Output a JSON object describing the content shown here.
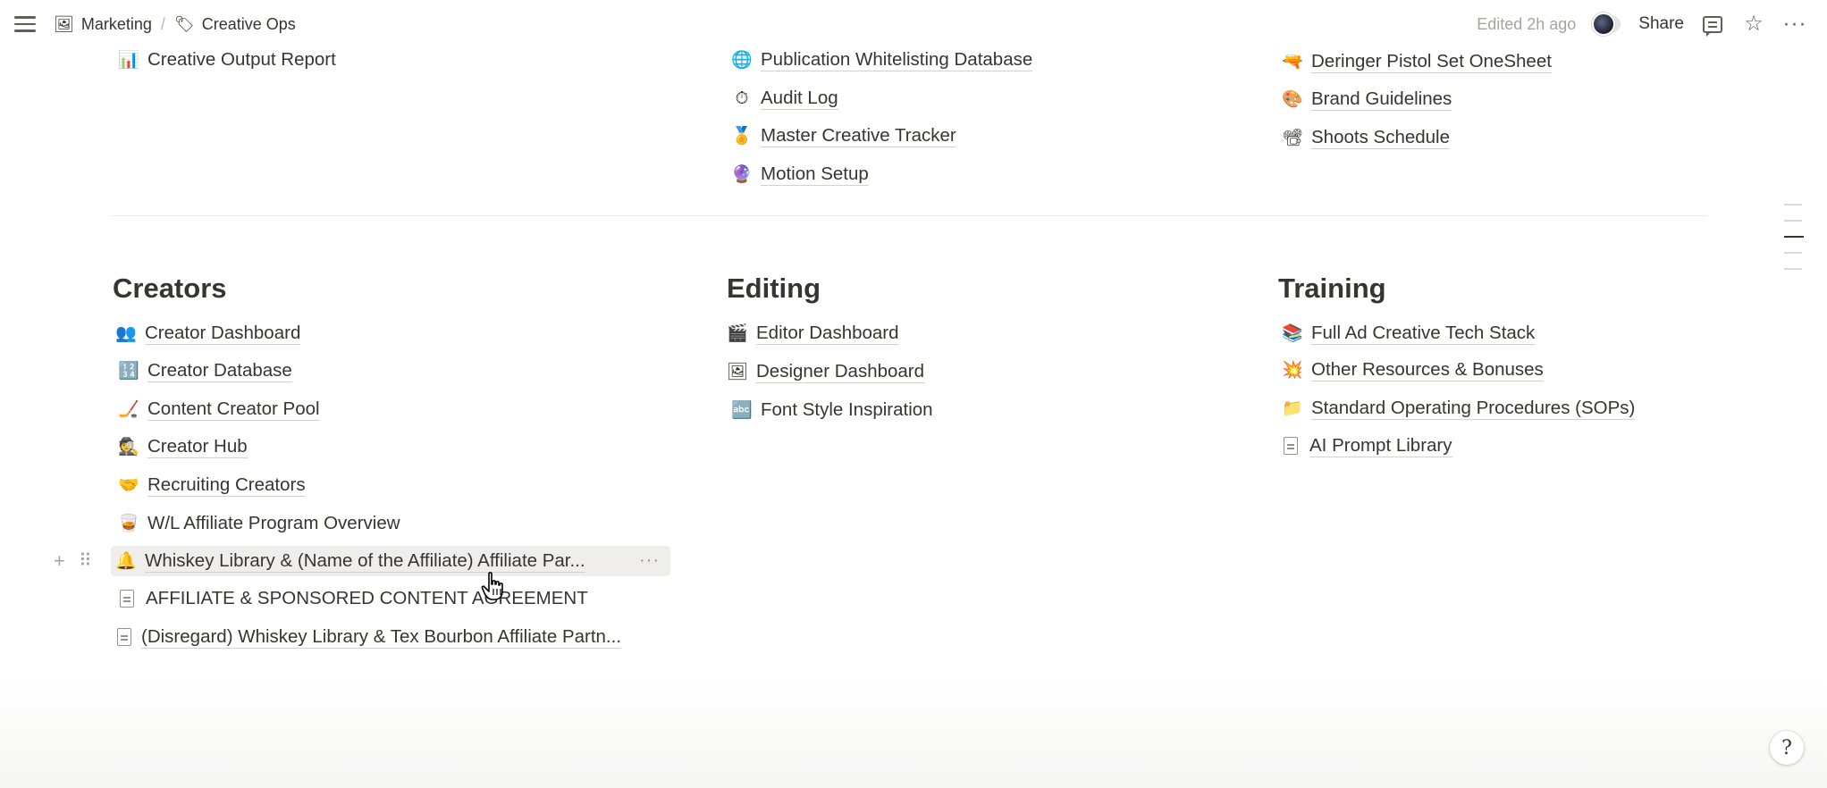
{
  "topbar": {
    "breadcrumb": [
      {
        "icon": "🖼",
        "label": "Marketing"
      },
      {
        "icon": "🏷",
        "label": "Creative Ops"
      }
    ],
    "edited": "Edited 2h ago",
    "share": "Share",
    "icons": [
      "menu-icon",
      "comment-icon",
      "star-icon",
      "more-icon"
    ]
  },
  "top_section": {
    "col1": [
      {
        "icon": "📊",
        "label": "Creative Output Report"
      }
    ],
    "col2": [
      {
        "icon": "🌐",
        "label": "Publication Whitelisting Database"
      },
      {
        "icon": "⏱",
        "label": "Audit Log"
      },
      {
        "icon": "🏅",
        "label": "Master Creative Tracker"
      },
      {
        "icon": "🔮",
        "label": "Motion Setup"
      }
    ],
    "col3": [
      {
        "icon": "🔫",
        "label": "Deringer Pistol Set OneSheet"
      },
      {
        "icon": "🎨",
        "label": "Brand Guidelines"
      },
      {
        "icon": "📽",
        "label": "Shoots Schedule"
      }
    ]
  },
  "creators": {
    "heading": "Creators",
    "items": [
      {
        "icon": "👥",
        "label": "Creator Dashboard"
      },
      {
        "icon": "🔢",
        "label": "Creator Database"
      },
      {
        "icon": "🏒",
        "label": "Content Creator Pool"
      },
      {
        "icon": "🕵",
        "label": "Creator Hub"
      },
      {
        "icon": "🤝",
        "label": "Recruiting Creators"
      },
      {
        "icon": "🥃",
        "label": "W/L Affiliate Program Overview"
      },
      {
        "icon": "🔔",
        "label": "Whiskey Library & (Name of the Affiliate) Affiliate Par..."
      },
      {
        "icon": "doc",
        "label": "AFFILIATE & SPONSORED CONTENT AGREEMENT"
      },
      {
        "icon": "doc",
        "label": "(Disregard) Whiskey Library & Tex Bourbon Affiliate Partn..."
      }
    ]
  },
  "editing": {
    "heading": "Editing",
    "items": [
      {
        "icon": "🎬",
        "label": "Editor Dashboard"
      },
      {
        "icon": "🖼",
        "label": "Designer Dashboard"
      },
      {
        "icon": "🔤",
        "label": "Font Style Inspiration"
      }
    ]
  },
  "training": {
    "heading": "Training",
    "items": [
      {
        "icon": "📚",
        "label": "Full Ad Creative Tech Stack"
      },
      {
        "icon": "💥",
        "label": "Other Resources & Bonuses"
      },
      {
        "icon": "📁",
        "label": "Standard Operating Procedures (SOPs)"
      },
      {
        "icon": "doc",
        "label": "AI Prompt Library"
      }
    ]
  },
  "row_controls": {
    "add": "+",
    "drag": "⠿",
    "more": "···"
  },
  "help": "?"
}
